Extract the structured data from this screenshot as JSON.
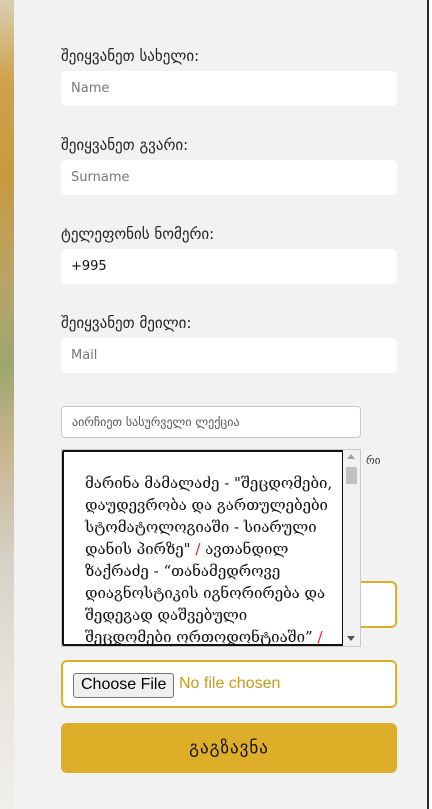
{
  "form": {
    "name_label": "შეიყვანეთ სახელი:",
    "name_placeholder": "Name",
    "surname_label": "შეიყვანეთ გვარი:",
    "surname_placeholder": "Surname",
    "phone_label": "ტელეფონის ნომერი:",
    "phone_value": "+995",
    "mail_label": "შეიყვანეთ მეილი:",
    "mail_placeholder": "Mail",
    "lecture_select": "აირჩიეთ სასურველი ლექცია",
    "tail_text": "რი",
    "lectures": [
      {
        "text": "მარინა მამალაძე - \"შეცდომები, დაუდევრობა და გართულებები სტომატოლოგიაში - სიარული დანის პირზე\""
      },
      {
        "text": "ავთანდილ ზაქრაძე - “თანამედროვე დიაგნოსტიკის იგნორირება და შედეგად დაშვებული შეცდომები ორთოდონტიაში”"
      }
    ],
    "separator": "/",
    "file_button": "Choose File",
    "file_status": "No file chosen",
    "submit": "გაგზავნა"
  }
}
